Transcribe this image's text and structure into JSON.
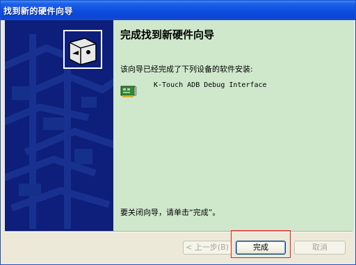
{
  "window": {
    "title": "找到新的硬件向导"
  },
  "content": {
    "heading": "完成找到新硬件向导",
    "description": "该向导已经完成了下列设备的软件安装:",
    "device_name": "K-Touch ADB Debug Interface",
    "device_icon": "network-adapter-icon",
    "footer_text": "要关闭向导，请单击“完成”。"
  },
  "buttons": {
    "back_label": "< 上一步(B)",
    "finish_label": "完成",
    "cancel_label": "取消"
  },
  "colors": {
    "title_bar": "#0a4de0",
    "side_panel": "#0d1f7a",
    "content_bg": "#cfe8cc",
    "highlight": "#e02020"
  }
}
